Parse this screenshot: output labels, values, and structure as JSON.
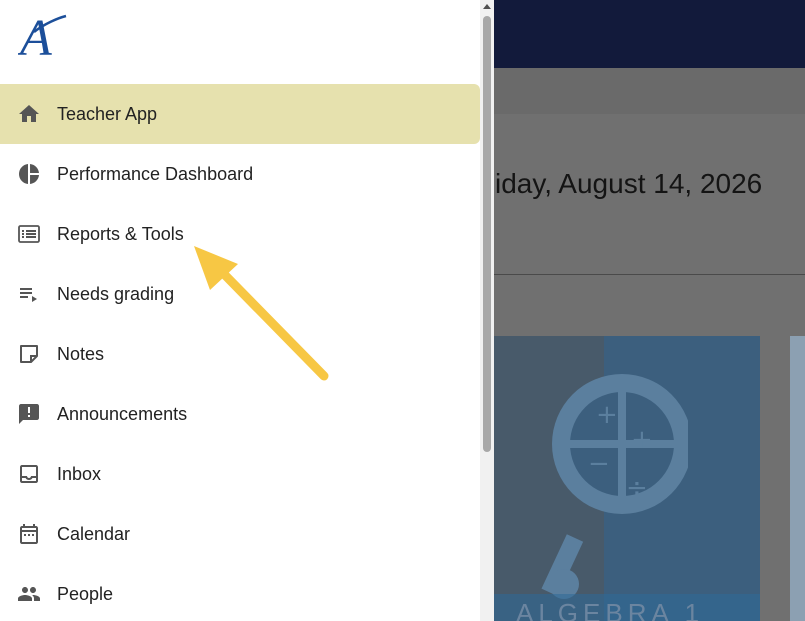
{
  "background": {
    "date_text": "iday, August 14, 2026",
    "course_card_title": "ALGEBRA 1"
  },
  "drawer": {
    "logo_text": "A",
    "items": [
      {
        "label": "Teacher App",
        "icon": "home-icon",
        "active": true
      },
      {
        "label": "Performance Dashboard",
        "icon": "pie-chart-icon",
        "active": false
      },
      {
        "label": "Reports & Tools",
        "icon": "list-icon",
        "active": false
      },
      {
        "label": "Needs grading",
        "icon": "playlist-play-icon",
        "active": false
      },
      {
        "label": "Notes",
        "icon": "sticky-note-icon",
        "active": false
      },
      {
        "label": "Announcements",
        "icon": "announcement-icon",
        "active": false
      },
      {
        "label": "Inbox",
        "icon": "inbox-icon",
        "active": false
      },
      {
        "label": "Calendar",
        "icon": "calendar-icon",
        "active": false
      },
      {
        "label": "People",
        "icon": "people-icon",
        "active": false
      }
    ]
  },
  "colors": {
    "active_item_bg": "#e6e1ae",
    "header_bg": "#121a3b",
    "logo_blue": "#1c4f9a",
    "annotation_arrow": "#f7c744"
  }
}
